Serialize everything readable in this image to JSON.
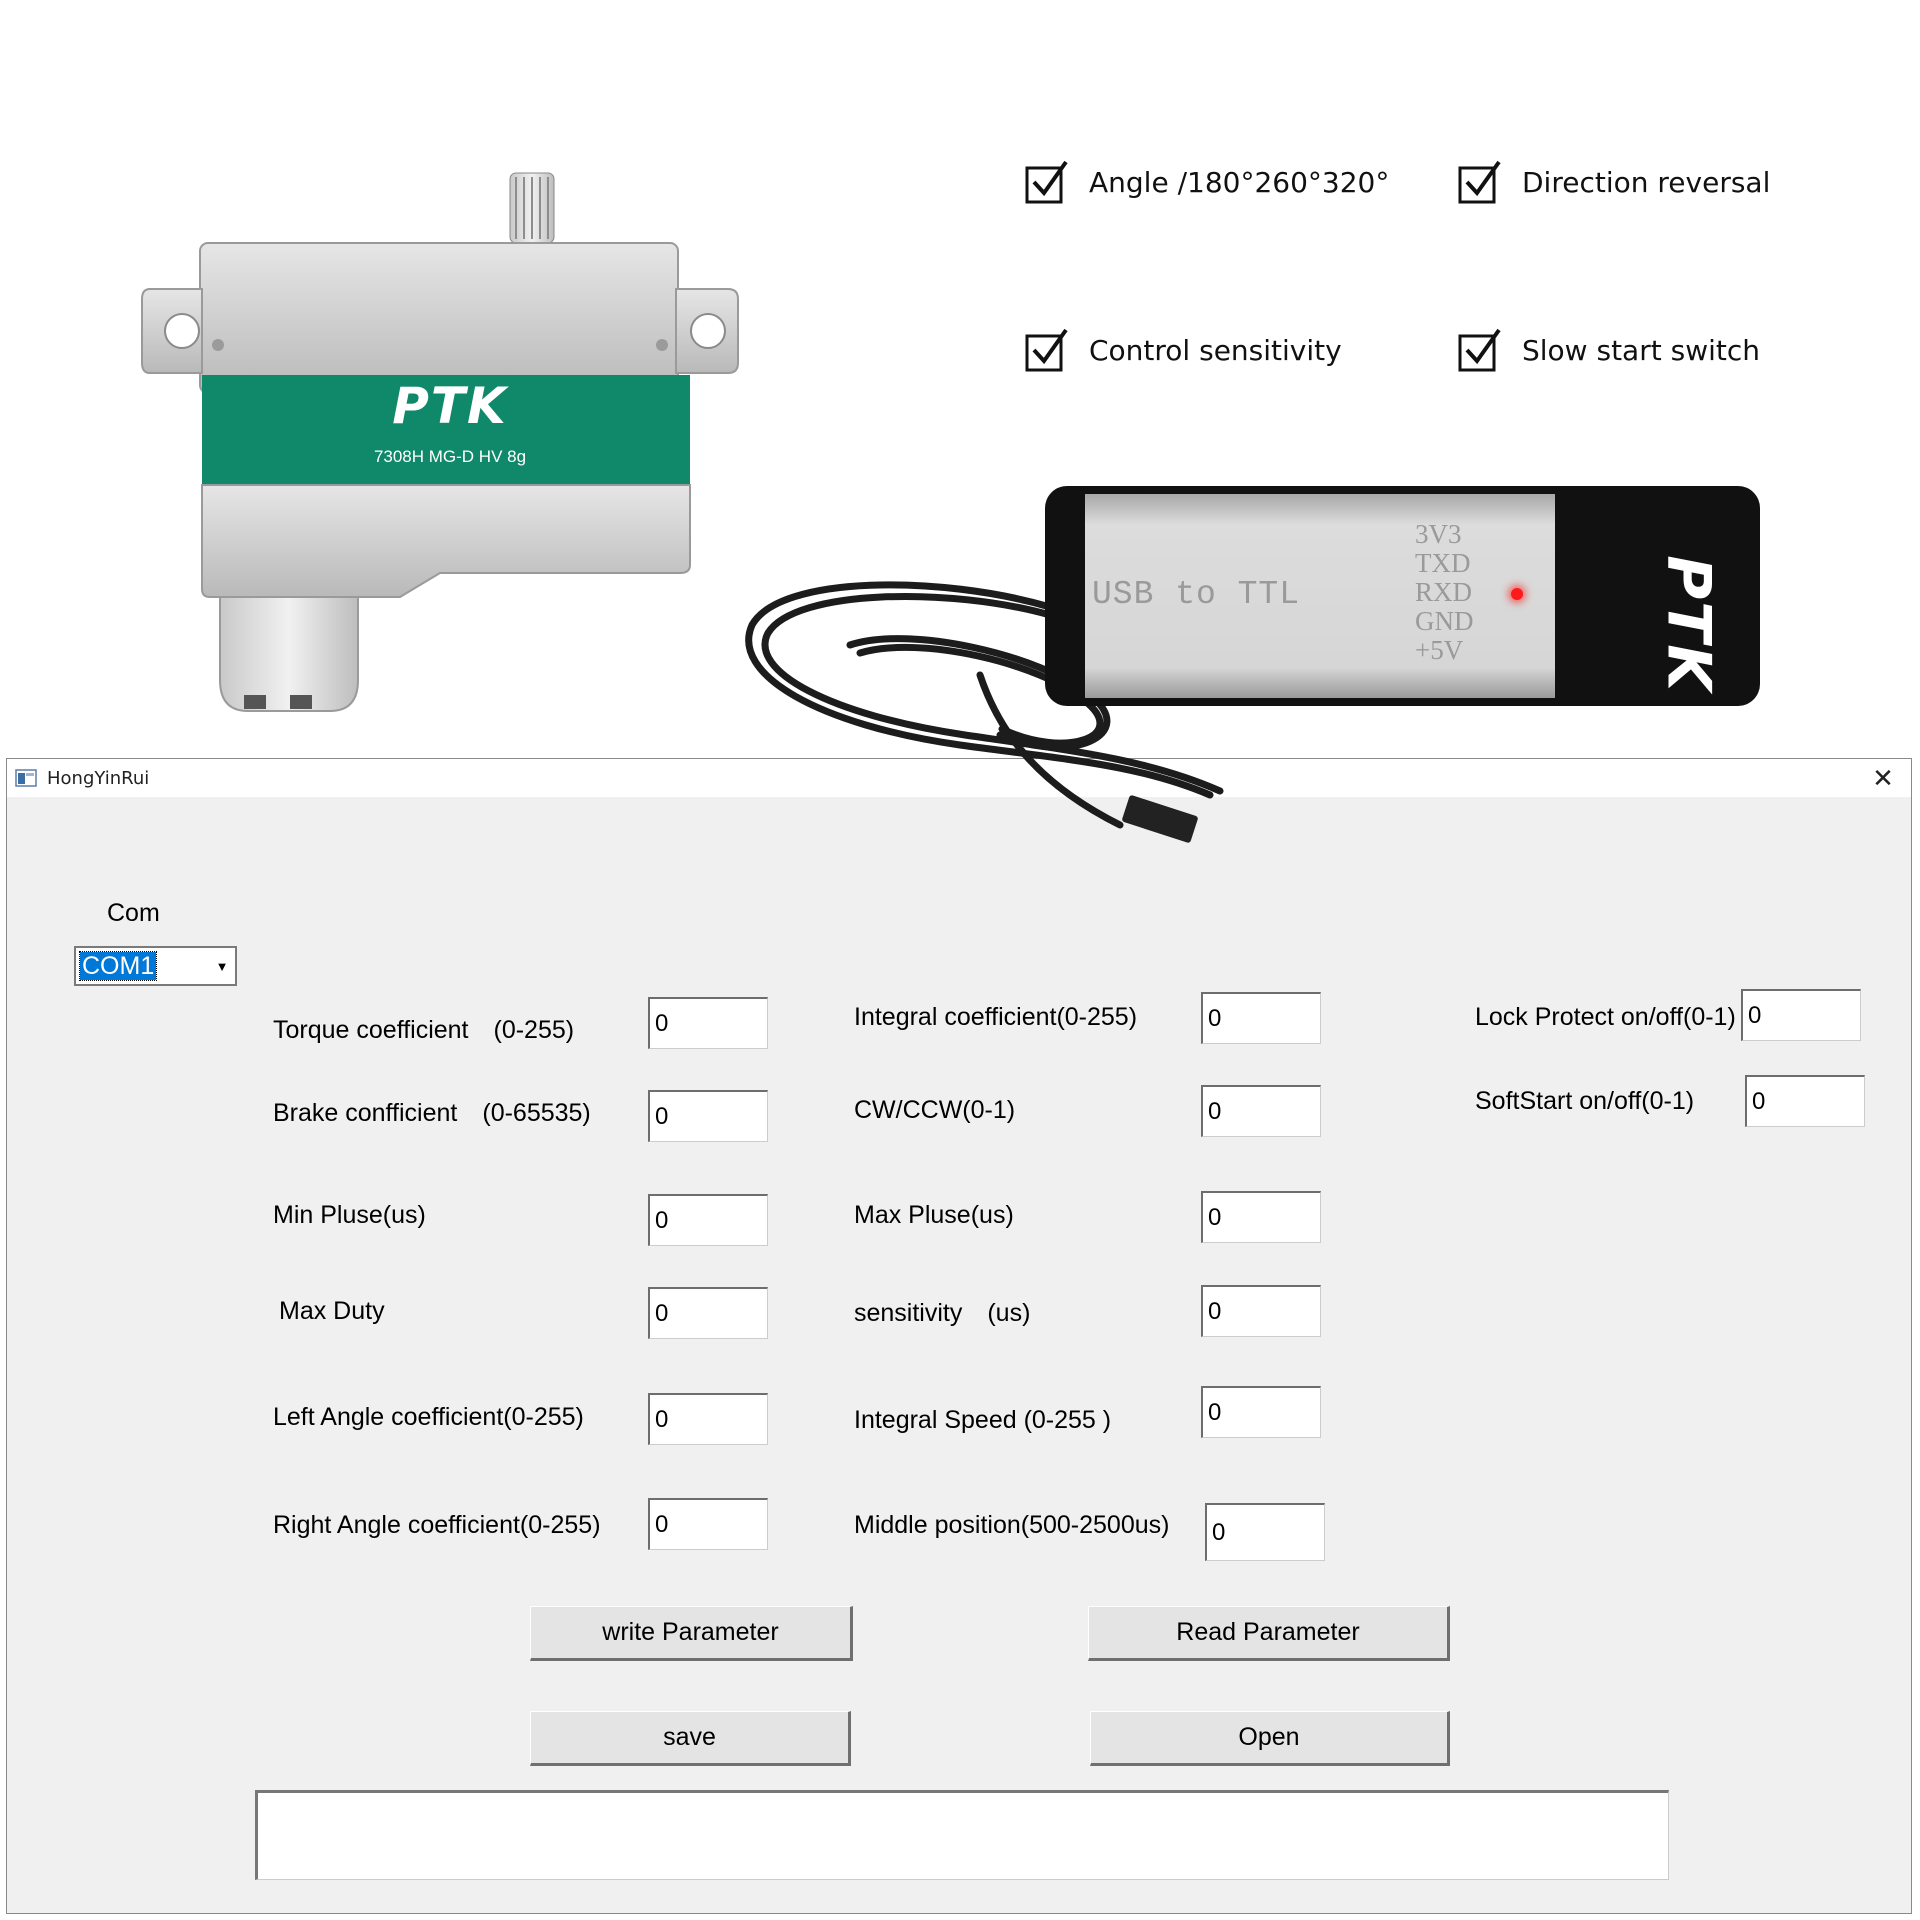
{
  "product": {
    "servo_brand": "PTK",
    "servo_model": "7308H MG-D HV 8g",
    "features": [
      {
        "label": "Angle /180°260°320°"
      },
      {
        "label": "Direction reversal"
      },
      {
        "label": "Control sensitivity"
      },
      {
        "label": "Slow start switch"
      }
    ],
    "adapter": {
      "label": "USB to TTL",
      "pins": [
        "3V3",
        "TXD",
        "RXD",
        "GND",
        "+5V"
      ],
      "brand": "PTK"
    }
  },
  "window": {
    "title": "HongYinRui",
    "close_icon": "close-icon",
    "com": {
      "label": "Com",
      "selected": "COM1"
    },
    "fields": {
      "torque": {
        "label": "Torque coefficient　(0-255)",
        "value": "0"
      },
      "brake": {
        "label": "Brake confficient　(0-65535)",
        "value": "0"
      },
      "min_pulse": {
        "label": "Min Pluse(us)",
        "value": "0"
      },
      "max_duty": {
        "label": "Max Duty",
        "value": "0"
      },
      "left_angle": {
        "label": "Left Angle coefficient(0-255)",
        "value": "0"
      },
      "right_angle": {
        "label": "Right Angle coefficient(0-255)",
        "value": "0"
      },
      "integral": {
        "label": "Integral coefficient(0-255)",
        "value": "0"
      },
      "cw_ccw": {
        "label": "CW/CCW(0-1)",
        "value": "0"
      },
      "max_pulse": {
        "label": "Max Pluse(us)",
        "value": "0"
      },
      "sensitivity": {
        "label": "sensitivity　(us)",
        "value": "0"
      },
      "integral_speed": {
        "label": "Integral Speed (0-255 )",
        "value": "0"
      },
      "middle": {
        "label": "Middle position(500-2500us)",
        "value": "0"
      },
      "lock_protect": {
        "label": "Lock Protect on/off(0-1)",
        "value": "0"
      },
      "softstart": {
        "label": "SoftStart on/off(0-1)",
        "value": "0"
      }
    },
    "buttons": {
      "write": "write Parameter",
      "read": "Read Parameter",
      "save": "save",
      "open": "Open"
    },
    "output_text": ""
  },
  "colors": {
    "servo_green": "#10896b",
    "selection_blue": "#0078d7",
    "window_bg": "#f0f0f0"
  }
}
